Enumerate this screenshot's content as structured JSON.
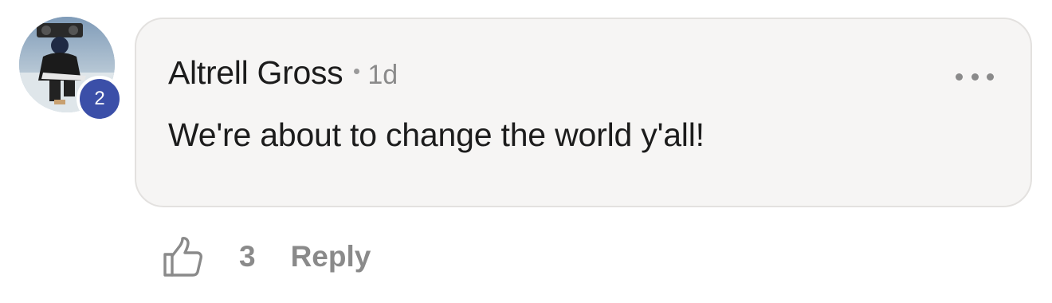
{
  "comment": {
    "author": "Altrell Gross",
    "timestamp": "1d",
    "text": "We're about to change the world y'all!",
    "level_badge": "2",
    "avatar_icon": "user-photo",
    "more_icon": "more-horizontal-icon"
  },
  "actions": {
    "like_icon": "thumbs-up-icon",
    "like_count": "3",
    "reply_label": "Reply"
  },
  "colors": {
    "bubble_background": "#f6f5f4",
    "badge_background": "#3b4fa8",
    "muted_text": "#8a8a8a",
    "primary_text": "#1c1c1c"
  }
}
